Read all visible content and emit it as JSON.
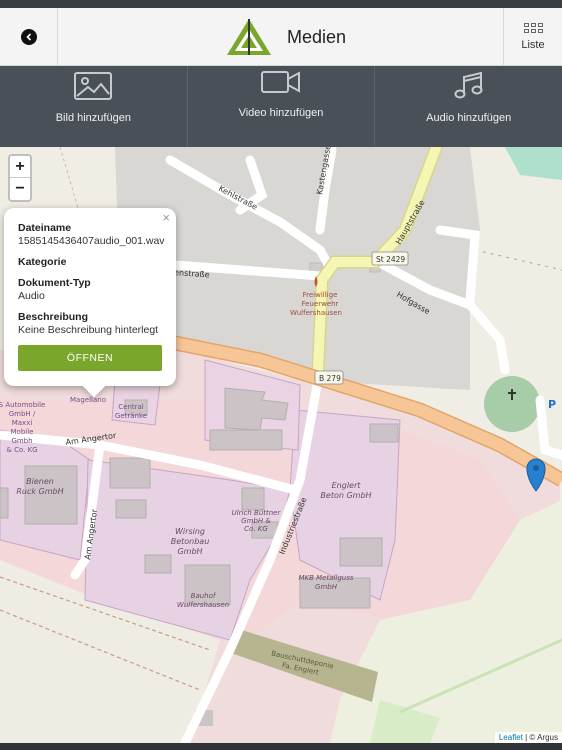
{
  "header": {
    "title": "Medien",
    "list_label": "Liste"
  },
  "media_buttons": [
    {
      "label": "Bild hinzufügen",
      "icon": "image-icon"
    },
    {
      "label": "Video hinzufügen",
      "icon": "video-camera-icon"
    },
    {
      "label": "Audio hinzufügen",
      "icon": "music-note-icon"
    }
  ],
  "map": {
    "zoom_in": "+",
    "zoom_out": "−",
    "labels": {
      "kehlstrasse": "Kehlstraße",
      "kastengasse": "Kastengasse",
      "hauptstrasse": "Hauptstraße",
      "st2429": "St 2429",
      "enstrasse": "enstraße",
      "hofgasse": "Hofgasse",
      "b279": "B 279",
      "am_angertor": "Am Angertor",
      "am_angertor_v": "Am Angertor",
      "industriestrasse": "Industriestraße",
      "feuerwehr_1": "Freiwillige",
      "feuerwehr_2": "Feuerwehr",
      "feuerwehr_3": "Wulfershausen",
      "automobile_1": "S Automobile",
      "automobile_2": "GmbH /",
      "automobile_3": "Maxxi",
      "automobile_4": "Mobile",
      "automobile_5": "Gmbh",
      "automobile_6": "& Co. KG",
      "magellano": "Magellano",
      "central_1": "Central",
      "central_2": "Getränke",
      "bienen_1": "Bienen",
      "bienen_2": "Ruck GmbH",
      "englert_1": "Englert",
      "englert_2": "Beton GmbH",
      "buettner_1": "Ulrich Büttner",
      "buettner_2": "GmbH &",
      "buettner_3": "Co. KG",
      "wirsing_1": "Wirsing",
      "wirsing_2": "Betonbau",
      "wirsing_3": "GmbH",
      "bauhof_1": "Bauhof",
      "bauhof_2": "Wulfershausen",
      "mkb_1": "MKB Metallguss",
      "mkb_2": "GmbH",
      "deponie_1": "Bauschuttdeponie",
      "deponie_2": "Fa. Englert",
      "parking": "P"
    },
    "attribution_link": "Leaflet",
    "attribution_rest": " | © Argus"
  },
  "popup": {
    "close": "×",
    "fields": [
      {
        "label": "Dateiname",
        "value": "1585145436407audio_001.wav"
      },
      {
        "label": "Kategorie",
        "value": ""
      },
      {
        "label": "Dokument-Typ",
        "value": "Audio"
      },
      {
        "label": "Beschreibung",
        "value": "Keine Beschreibung hinterlegt"
      }
    ],
    "open_button": "ÖFFNEN"
  },
  "colors": {
    "accent": "#7aa62c",
    "marker": "#2a80d0",
    "toolbar": "#4a5057"
  }
}
